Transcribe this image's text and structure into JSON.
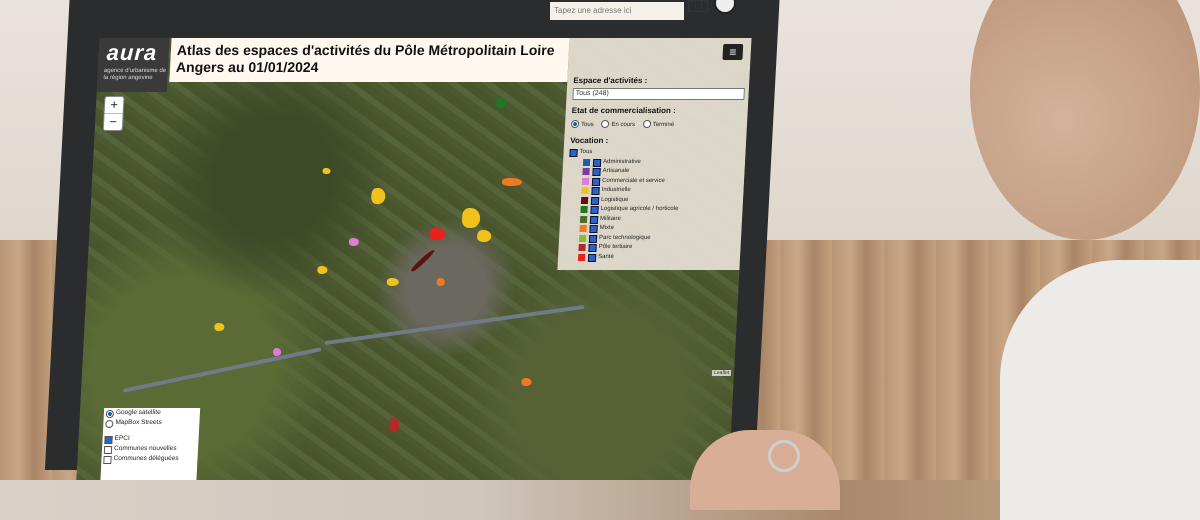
{
  "browser": {
    "address_placeholder": "Tapez une adresse ici"
  },
  "header": {
    "logo": "aura",
    "logo_subtitle": "agence d'urbanisme de la région angevine",
    "title": "Atlas des espaces d'activités du Pôle Métropolitain Loire Angers au 01/01/2024"
  },
  "zoom": {
    "in": "+",
    "out": "−"
  },
  "panel": {
    "espace_label": "Espace d'activités :",
    "espace_selected": "Tous (248)",
    "etat_label": "Etat de commercialisation :",
    "etat_options": [
      "Tous",
      "En cours",
      "Terminé"
    ],
    "vocation_label": "Vocation :",
    "vocation_all": "Tous",
    "vocations": [
      {
        "label": "Administrative",
        "color": "#1f5fa8"
      },
      {
        "label": "Artisanale",
        "color": "#7b3f9b"
      },
      {
        "label": "Commerciale et service",
        "color": "#e07bd6"
      },
      {
        "label": "Industrielle",
        "color": "#f2c21c"
      },
      {
        "label": "Logistique",
        "color": "#5a1410"
      },
      {
        "label": "Logistique agricole / horticole",
        "color": "#1e7a1e"
      },
      {
        "label": "Militaire",
        "color": "#4e6b2a"
      },
      {
        "label": "Mixte",
        "color": "#f27a1e"
      },
      {
        "label": "Parc technologique",
        "color": "#7fbf3a"
      },
      {
        "label": "Pôle tertiaire",
        "color": "#b22a2a"
      },
      {
        "label": "Santé",
        "color": "#e8211c"
      }
    ]
  },
  "layers": {
    "base": [
      "Google satellite",
      "MapBox Streets"
    ],
    "overlays": [
      "EPCI",
      "Communes nouvelles",
      "Communes déléguées"
    ]
  },
  "attribution": "Leaflet"
}
